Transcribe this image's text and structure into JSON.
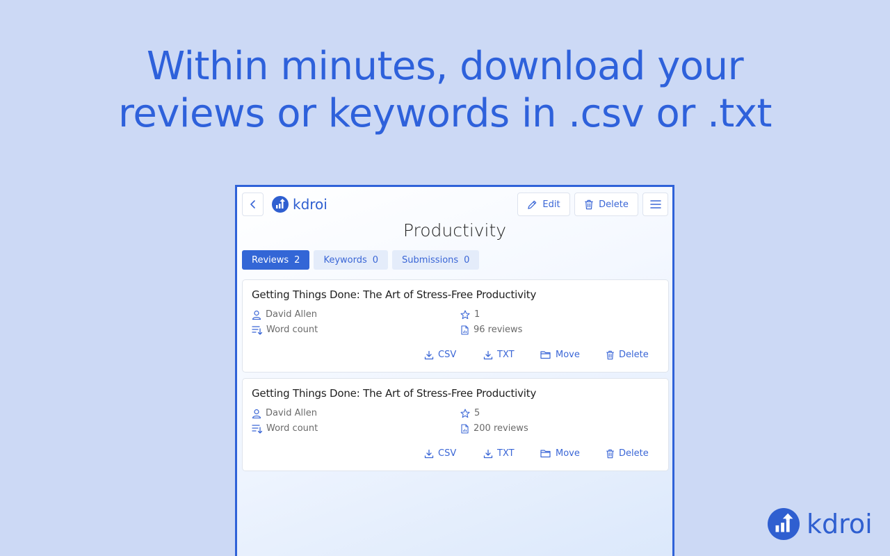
{
  "headline": {
    "line1": "Within minutes, download your",
    "line2": "reviews or keywords in .csv or .txt"
  },
  "app": {
    "logo_text": "kdroi",
    "edit_label": "Edit",
    "delete_label": "Delete",
    "page_title": "Productivity"
  },
  "tabs": [
    {
      "label": "Reviews",
      "count": "2",
      "active": true
    },
    {
      "label": "Keywords",
      "count": "0",
      "active": false
    },
    {
      "label": "Submissions",
      "count": "0",
      "active": false
    }
  ],
  "cards": [
    {
      "title": "Getting Things Done: The Art of Stress-Free Productivity",
      "author": "David Allen",
      "word_count": "Word count",
      "rating": "1",
      "reviews": "96 reviews",
      "csv": "CSV",
      "txt": "TXT",
      "move": "Move",
      "delete": "Delete"
    },
    {
      "title": "Getting Things Done: The Art of Stress-Free Productivity",
      "author": "David Allen",
      "word_count": "Word count",
      "rating": "5",
      "reviews": "200 reviews",
      "csv": "CSV",
      "txt": "TXT",
      "move": "Move",
      "delete": "Delete"
    }
  ],
  "brand": {
    "logo_text": "kdroi"
  },
  "colors": {
    "accent": "#3366d6",
    "background": "#ccd9f5",
    "headline": "#2e61db"
  }
}
